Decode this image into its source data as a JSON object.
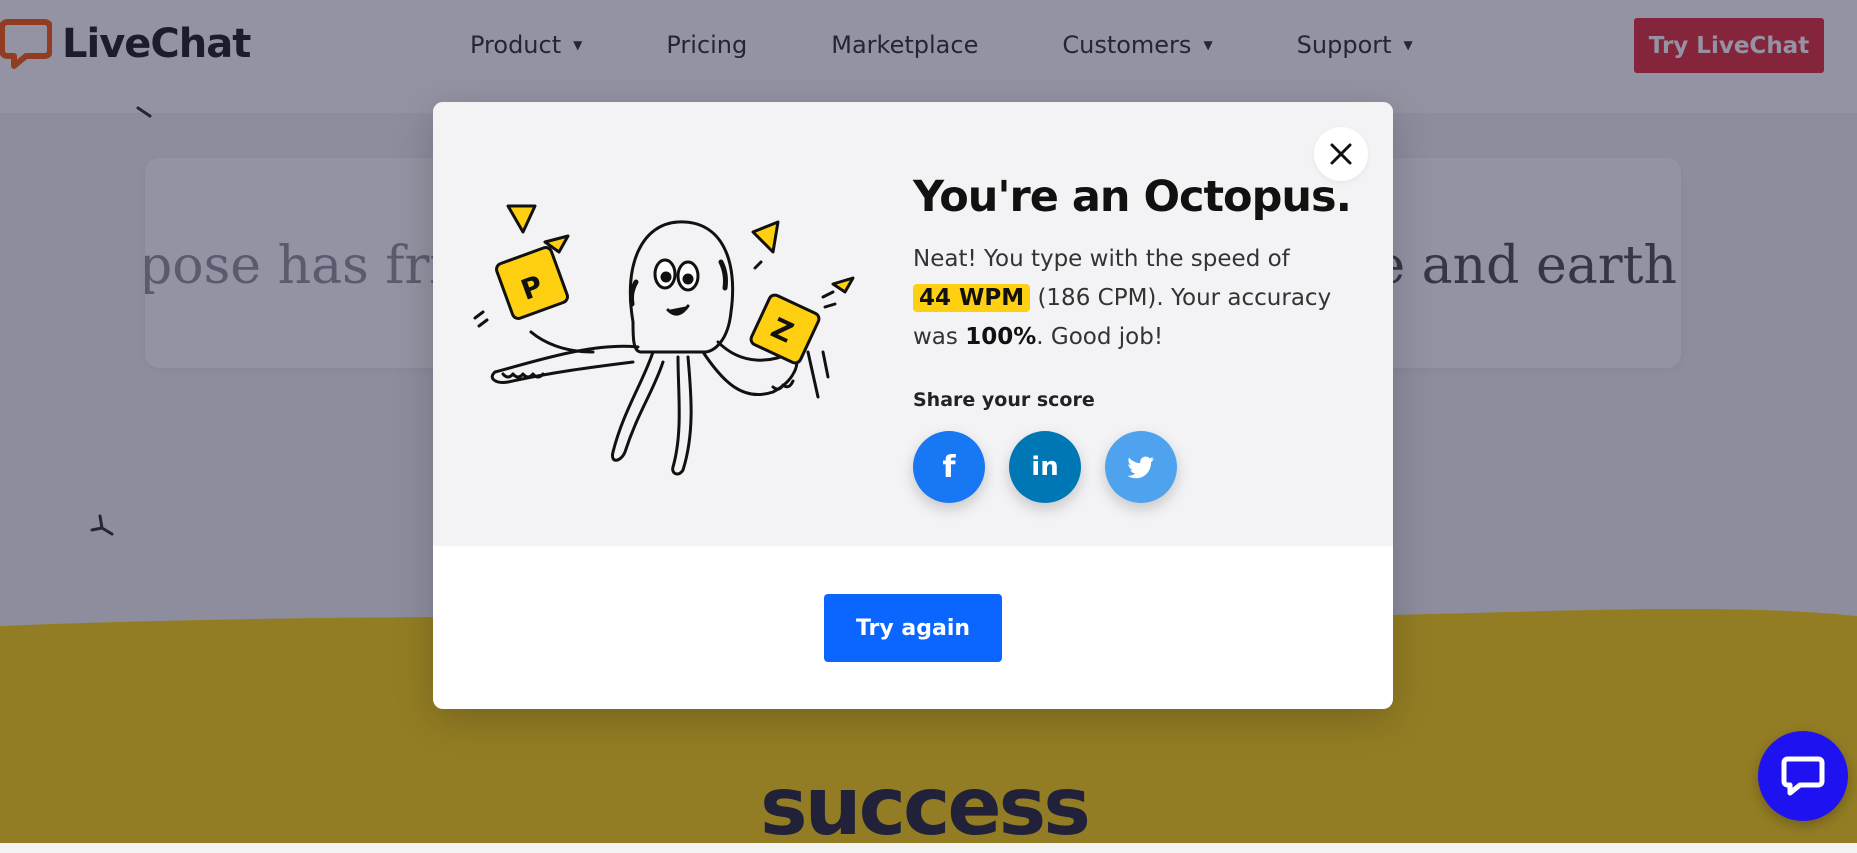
{
  "header": {
    "brand": "LiveChat",
    "nav": [
      {
        "label": "Product",
        "has_dropdown": true
      },
      {
        "label": "Pricing",
        "has_dropdown": false
      },
      {
        "label": "Marketplace",
        "has_dropdown": false
      },
      {
        "label": "Customers",
        "has_dropdown": true
      },
      {
        "label": "Support",
        "has_dropdown": true
      }
    ],
    "cta_label": "Try LiveChat",
    "dropdown_icon": "caret-down-icon"
  },
  "background": {
    "typing_text_left": "pose has frie",
    "typing_text_right": "ve and earth",
    "section_heading": "success"
  },
  "modal": {
    "title": "You're an Octopus.",
    "result_intro": "Neat! You type with the speed of",
    "wpm": "44 WPM",
    "cpm_text": "(186 CPM). Your accuracy",
    "accuracy_prefix": "was",
    "accuracy": "100%",
    "accuracy_suffix": ". Good job!",
    "share_label": "Share your score",
    "share_buttons": [
      {
        "icon": "facebook-icon",
        "glyph": "f"
      },
      {
        "icon": "linkedin-icon",
        "glyph": "in"
      },
      {
        "icon": "twitter-icon",
        "glyph": ""
      }
    ],
    "try_again_label": "Try again",
    "close_icon": "close-icon",
    "illustration": "octopus-illustration",
    "illustration_keys": [
      "P",
      "Z"
    ]
  },
  "chat_widget": {
    "icon": "chat-bubble-icon"
  },
  "colors": {
    "brand_orange": "#ff5100",
    "cta_red": "#e0232f",
    "highlight_yellow": "#ffd011",
    "try_again_blue": "#0a66ff",
    "facebook_blue": "#1877f2",
    "linkedin_blue": "#0077b5",
    "twitter_blue": "#4ea2ee",
    "chat_widget_blue": "#1f12f0",
    "wave_yellow": "#ffd200"
  }
}
